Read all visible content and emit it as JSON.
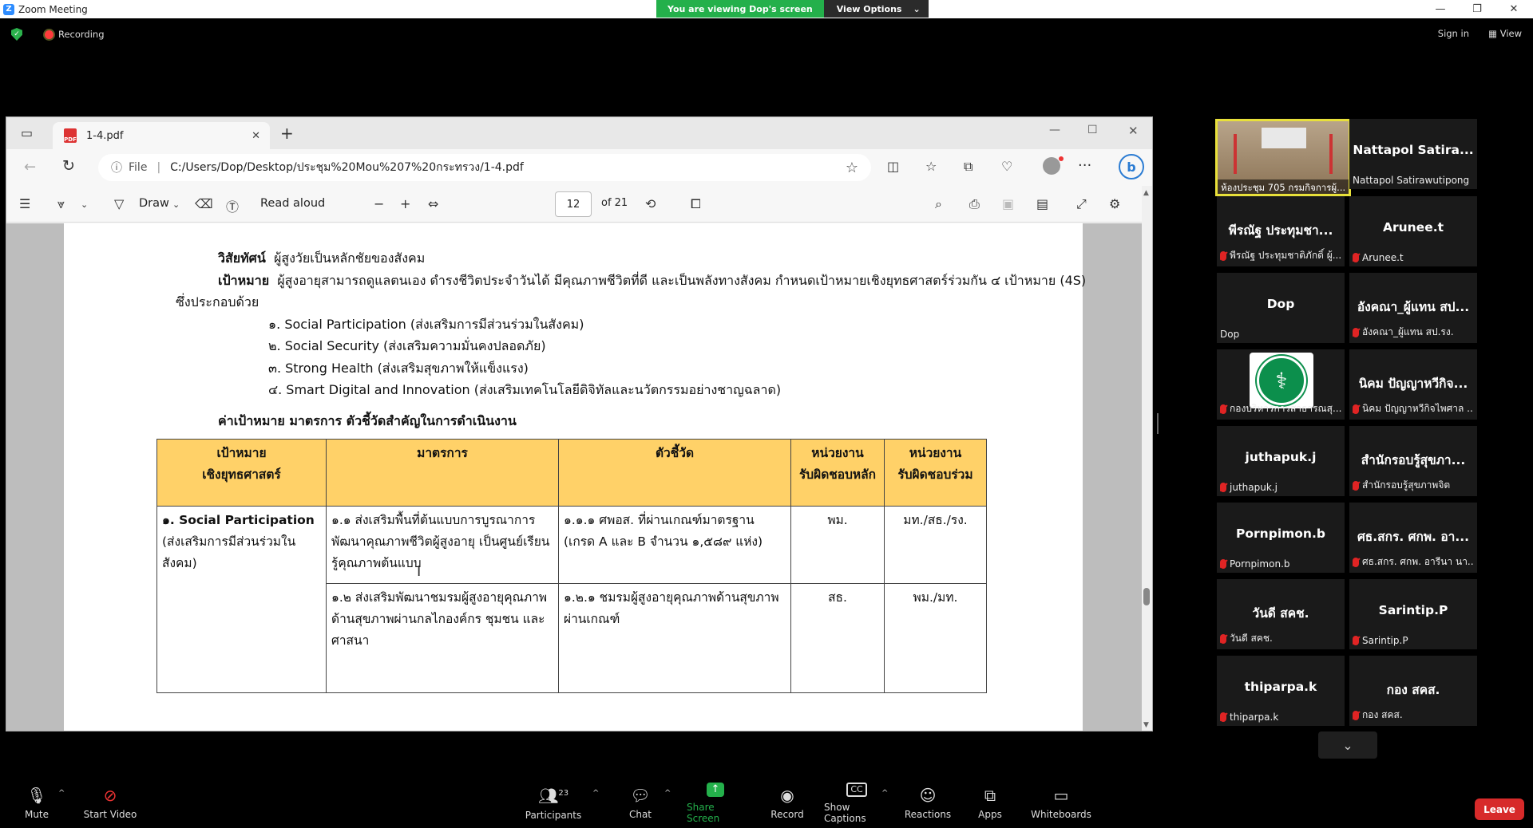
{
  "zoom": {
    "app_title": "Zoom Meeting",
    "viewing_banner": "You are viewing Dop's screen",
    "view_options": "View Options",
    "recording_label": "Recording",
    "sign_in": "Sign in",
    "view": "View",
    "leave": "Leave"
  },
  "edge": {
    "tab_title": "1-4.pdf",
    "address_prefix": "File",
    "address_url": "C:/Users/Dop/Desktop/ประชุม%20Mou%207%20กระทรวง/1-4.pdf",
    "draw_label": "Draw",
    "read_aloud_label": "Read aloud",
    "page_number": "12",
    "page_total": "of 21"
  },
  "document": {
    "vision_label": "วิสัยทัศน์",
    "vision_text": "ผู้สูงวัยเป็นหลักชัยของสังคม",
    "goal_label": "เป้าหมาย",
    "goal_text": "ผู้สูงอายุสามารถดูแลตนเอง ดำรงชีวิตประจำวันได้ มีคุณภาพชีวิตที่ดี และเป็นพลังทางสังคม กำหนดเป้าหมายเชิงยุทธศาสตร์ร่วมกัน ๔ เป้าหมาย (4S)",
    "goal_cont": "ซึ่งประกอบด้วย",
    "items": [
      "๑. Social Participation (ส่งเสริมการมีส่วนร่วมในสังคม)",
      "๒. Social Security (ส่งเสริมความมั่นคงปลอดภัย)",
      "๓. Strong Health (ส่งเสริมสุขภาพให้แข็งแรง)",
      "๔. Smart Digital and Innovation (ส่งเสริมเทคโนโลยีดิจิทัลและนวัตกรรมอย่างชาญฉลาด)"
    ],
    "table_heading": "ค่าเป้าหมาย มาตรการ ตัวชี้วัดสำคัญในการดำเนินงาน",
    "headers": {
      "goal_l1": "เป้าหมาย",
      "goal_l2": "เชิงยุทธศาสตร์",
      "measure": "มาตรการ",
      "indicator": "ตัวชี้วัด",
      "main_l1": "หน่วยงาน",
      "main_l2": "รับผิดชอบหลัก",
      "joint_l1": "หน่วยงาน",
      "joint_l2": "รับผิดชอบร่วม"
    },
    "row1": {
      "goal_title": "๑. Social Participation",
      "goal_sub": "(ส่งเสริมการมีส่วนร่วมใน สังคม)",
      "measure": "๑.๑ ส่งเสริมพื้นที่ต้นแบบการบูรณาการพัฒนาคุณภาพชีวิตผู้สูงอายุ เป็นศูนย์เรียนรู้คุณภาพต้นแบบ",
      "indicator": "๑.๑.๑ ศพอส. ที่ผ่านเกณฑ์มาตรฐาน (เกรด A และ B จำนวน ๑,๕๘๙ แห่ง)",
      "main": "พม.",
      "joint": "มท./สธ./รง."
    },
    "row2": {
      "measure": "๑.๒ ส่งเสริมพัฒนาชมรมผู้สูงอายุคุณภาพด้านสุขภาพผ่านกลไกองค์กร ชุมชน และศาสนา",
      "indicator": "๑.๒.๑ ชมรมผู้สูงอายุคุณภาพด้านสุขภาพผ่านเกณฑ์",
      "main": "สธ.",
      "joint": "พม./มท."
    }
  },
  "participants": [
    {
      "name": "",
      "sub": "ห้องประชุม 705 กรมกิจการผู้..."
    },
    {
      "name": "Nattapol Satira...",
      "sub": "Nattapol Satirawutipong"
    },
    {
      "name": "พีรณัฐ ประทุมชา...",
      "sub": "พีรณัฐ ประทุมชาติภักดิ์ ผู้..."
    },
    {
      "name": "Arunee.t",
      "sub": "Arunee.t"
    },
    {
      "name": "Dop",
      "sub": "Dop"
    },
    {
      "name": "อังคณา_ผู้แทน สป...",
      "sub": "อังคณา_ผู้แทน สป.รง."
    },
    {
      "name": "",
      "sub": "กองบริหารการสาธารณสุ..."
    },
    {
      "name": "นิคม ปัญญาหวีกิจ...",
      "sub": "นิคม ปัญญาหวีกิจไพศาล ..."
    },
    {
      "name": "juthapuk.j",
      "sub": "juthapuk.j"
    },
    {
      "name": "สำนักรอบรู้สุขภา...",
      "sub": "สำนักรอบรู้สุขภาพจิต"
    },
    {
      "name": "Pornpimon.b",
      "sub": "Pornpimon.b"
    },
    {
      "name": "ศธ.สกร. ศกพ. อา...",
      "sub": "ศธ.สกร. ศกพ. อารีนา นา..."
    },
    {
      "name": "วันดี สคช.",
      "sub": "วันดี สคช."
    },
    {
      "name": "Sarintip.P",
      "sub": "Sarintip.P"
    },
    {
      "name": "thiparpa.k",
      "sub": "thiparpa.k"
    },
    {
      "name": "กอง สคส.",
      "sub": "กอง สคส."
    }
  ],
  "toolbar": {
    "mute": "Mute",
    "start_video": "Start Video",
    "participants": "Participants",
    "participant_count": "23",
    "chat": "Chat",
    "share_screen": "Share Screen",
    "record": "Record",
    "show_captions": "Show Captions",
    "reactions": "Reactions",
    "apps": "Apps",
    "whiteboards": "Whiteboards"
  },
  "colors": {
    "zoom_blue": "#2D8CFF",
    "banner_green": "#24B04B",
    "table_header": "#FFD168",
    "leave_red": "#D72A2A",
    "active_speaker": "#E8E03A"
  }
}
